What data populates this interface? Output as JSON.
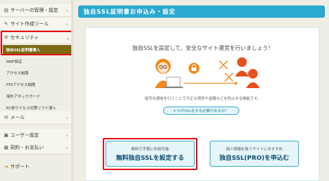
{
  "sidebar": {
    "items": [
      {
        "label": "サーバーの管理・設定",
        "icon": "gear-icon",
        "chevron": "›"
      },
      {
        "label": "サイト作成ツール",
        "icon": "pencil-icon",
        "chevron": "›"
      },
      {
        "label": "セキュリティ",
        "icon": "shield-icon",
        "chevron": "⌄"
      }
    ],
    "sub_items": [
      {
        "label": "独自SSL証明書導入",
        "active": true
      },
      {
        "label": "WAF設定"
      },
      {
        "label": "アクセス制限"
      },
      {
        "label": "FTPアクセス制限"
      },
      {
        "label": "海外アタックガード"
      },
      {
        "label": "PC用ウイルス対策ソフト導入"
      }
    ],
    "bottom_items": [
      {
        "label": "メール",
        "icon": "mail-icon",
        "chevron": "›"
      },
      {
        "label": "ユーザー設定",
        "icon": "user-icon",
        "chevron": "›"
      },
      {
        "label": "契約・お支払い",
        "icon": "wallet-icon",
        "chevron": "›"
      },
      {
        "label": "サポート",
        "icon": "arrow-icon",
        "chevron": ""
      }
    ]
  },
  "header": {
    "title": "独自SSL証明書お申込み・設定"
  },
  "panel": {
    "lead": "独自SSLを設定して、安全なサイト運営を行いましょう！",
    "note": "暗号化通信を行うことで不正な傍受や盗聴などを防止する機能です。",
    "why_link": "▾ なぜSSL化する必要があるの？"
  },
  "cta_free": {
    "small": "無料で手軽に利用可能",
    "big": "無料独自SSLを設定する"
  },
  "cta_pro": {
    "small": "個人情報を扱うサイトにおすすめ",
    "big": "独自SSL(PRO)を申込む"
  },
  "colors": {
    "accent": "#2aaad0",
    "highlight": "#e60012",
    "active_bg": "#7b6a12",
    "person": "#f08a1c",
    "attacker": "#e8501a"
  }
}
